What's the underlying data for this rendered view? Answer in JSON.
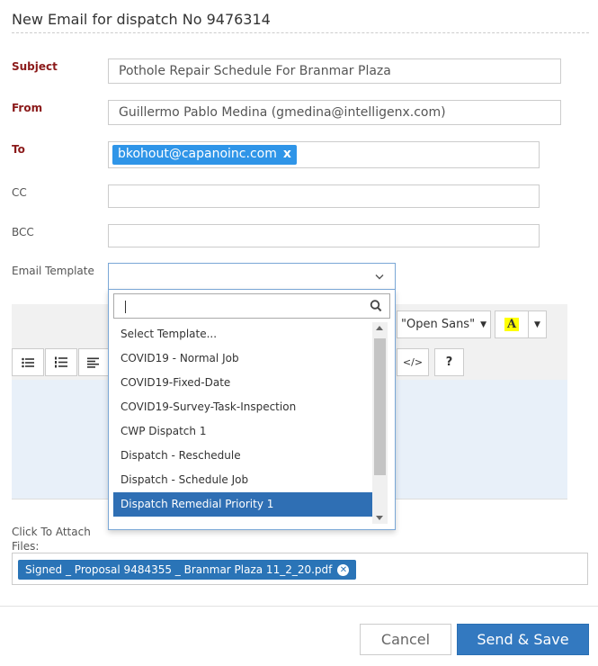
{
  "dialog": {
    "title": "New Email for dispatch No 9476314"
  },
  "form": {
    "subject_label": "Subject",
    "subject_value": "Pothole Repair Schedule For Branmar Plaza",
    "from_label": "From",
    "from_value": "Guillermo Pablo Medina (gmedina@intelligenx.com)",
    "to_label": "To",
    "to_recipients": [
      {
        "email": "bkohout@capanoinc.com",
        "remove": "x"
      }
    ],
    "cc_label": "CC",
    "cc_value": "",
    "bcc_label": "BCC",
    "bcc_value": "",
    "template_label": "Email Template",
    "template_value": ""
  },
  "template_dropdown": {
    "search_value": "",
    "options": [
      "Select Template...",
      "COVID19 - Normal Job",
      "COVID19-Fixed-Date",
      "COVID19-Survey-Task-Inspection",
      "CWP Dispatch 1",
      "Dispatch - Reschedule",
      "Dispatch - Schedule Job",
      "Dispatch Remedial Priority 1"
    ],
    "highlighted": "Dispatch Remedial Priority 1"
  },
  "editor": {
    "font_name": "\"Open Sans\"",
    "highlight_letter": "A",
    "code_view": "</>",
    "help": "?"
  },
  "attachments": {
    "label": "Click To Attach Files:",
    "files": [
      {
        "name": "Signed _ Proposal 9484355 _ Branmar Plaza 11_2_20.pdf"
      }
    ]
  },
  "footer": {
    "cancel_label": "Cancel",
    "send_label": "Send & Save"
  },
  "colors": {
    "primary": "#3379c0",
    "tag": "#2f95e8",
    "required_label": "#8b1a1a",
    "highlight": "#ffff00"
  }
}
